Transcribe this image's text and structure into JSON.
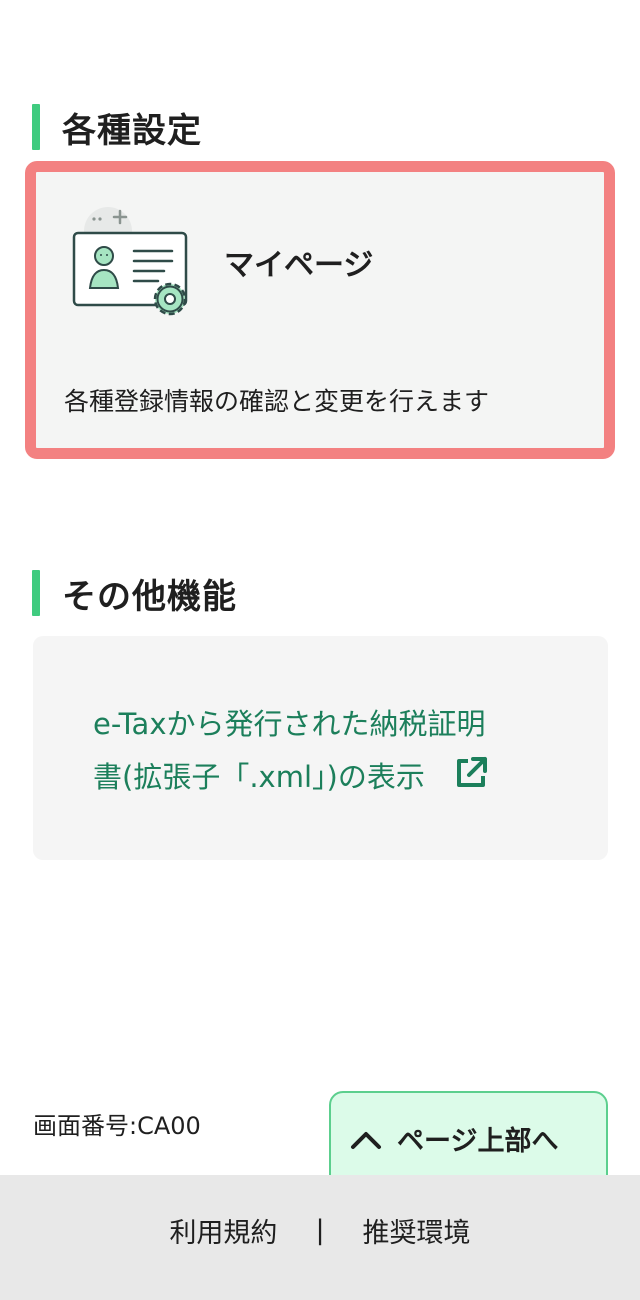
{
  "sections": {
    "settings_title": "各種設定",
    "other_title": "その他機能"
  },
  "mypage": {
    "title": "マイページ",
    "description": "各種登録情報の確認と変更を行えます",
    "icon": "profile-settings-icon"
  },
  "other": {
    "link_line1": "e-Taxから発行された納税証明",
    "link_line2": "書(拡張子「.xml」)の表示",
    "icon": "external-link-icon"
  },
  "screen_number": "画面番号:CA00",
  "page_top": {
    "label": "ページ上部へ",
    "icon": "chevron-up-icon"
  },
  "footer": {
    "terms": "利用規約",
    "separator": "|",
    "environment": "推奨環境"
  },
  "colors": {
    "accent_green": "#3fcb7f",
    "highlight_border": "#f38181",
    "link_green": "#1c7f5b",
    "page_top_bg": "#dcfbe9"
  }
}
